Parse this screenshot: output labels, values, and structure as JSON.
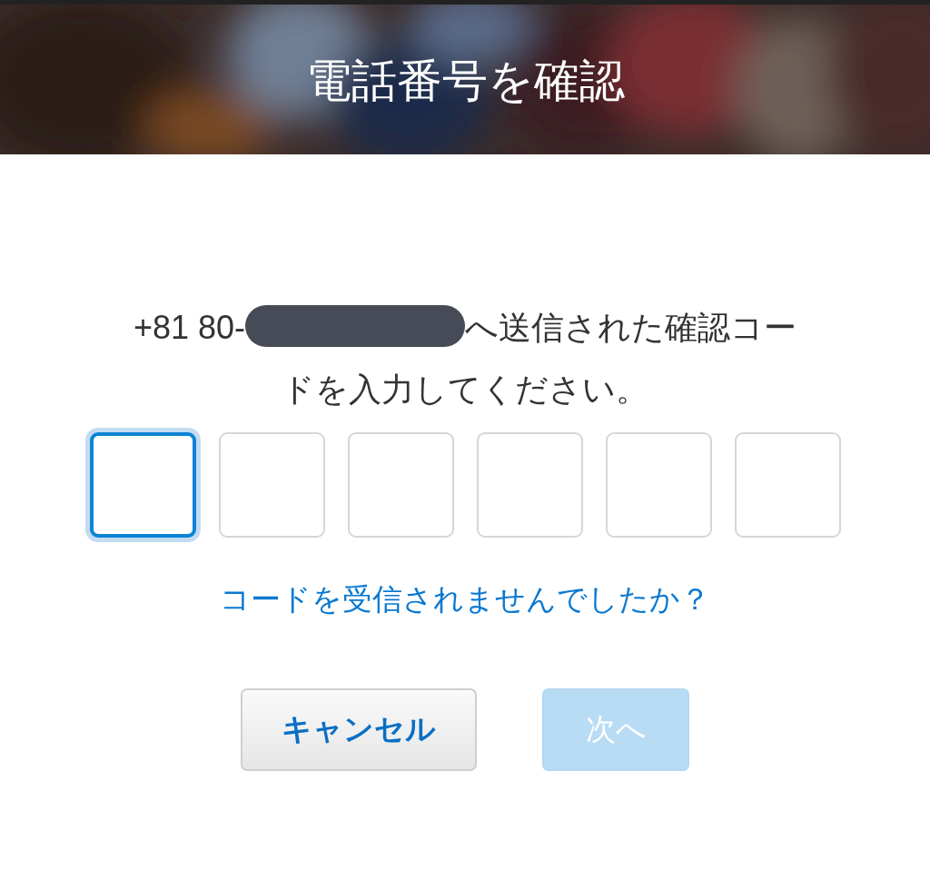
{
  "header": {
    "title": "電話番号を確認"
  },
  "message": {
    "before": "+81 80-",
    "redacted": true,
    "after": "へ送信された確認コー",
    "continued": "ドを入力してください。"
  },
  "code_boxes": [
    {
      "selected": true
    },
    {
      "selected": false
    },
    {
      "selected": false
    },
    {
      "selected": false
    },
    {
      "selected": false
    },
    {
      "selected": false
    }
  ],
  "resend_link": "コードを受信されませんでしたか？",
  "buttons": [
    {
      "label": "キャンセル",
      "kind": "secondary",
      "disabled": false
    },
    {
      "label": "次へ",
      "kind": "primary",
      "disabled": true
    }
  ]
}
